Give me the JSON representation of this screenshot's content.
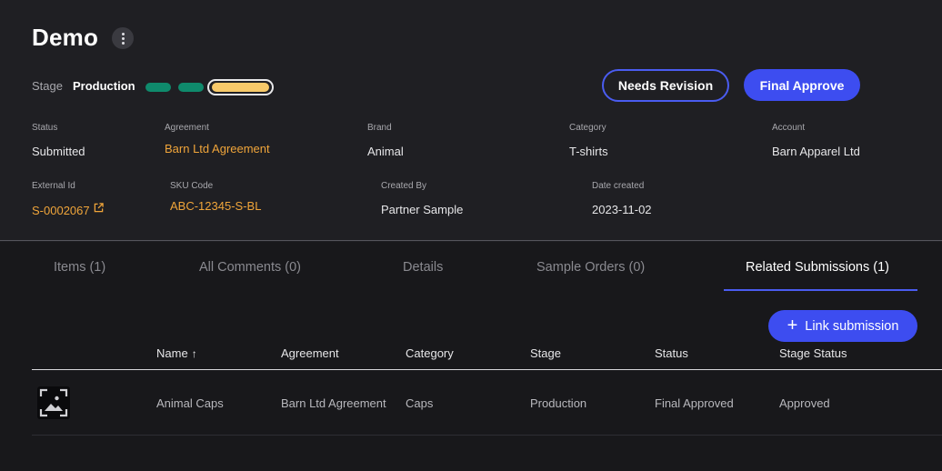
{
  "header": {
    "title": "Demo",
    "stage_label": "Stage",
    "stage_value": "Production"
  },
  "actions": {
    "needs_revision": "Needs Revision",
    "final_approve": "Final Approve"
  },
  "fields": {
    "status": {
      "label": "Status",
      "value": "Submitted"
    },
    "agreement": {
      "label": "Agreement",
      "value": "Barn Ltd Agreement"
    },
    "brand": {
      "label": "Brand",
      "value": "Animal"
    },
    "category": {
      "label": "Category",
      "value": "T-shirts"
    },
    "account": {
      "label": "Account",
      "value": "Barn Apparel Ltd"
    },
    "external_id": {
      "label": "External Id",
      "value": "S-0002067"
    },
    "sku_code": {
      "label": "SKU Code",
      "value": "ABC-12345-S-BL"
    },
    "created_by": {
      "label": "Created By",
      "value": "Partner Sample"
    },
    "date_created": {
      "label": "Date created",
      "value": "2023-11-02"
    }
  },
  "tabs": [
    {
      "label": "Items (1)"
    },
    {
      "label": "All Comments (0)"
    },
    {
      "label": "Details"
    },
    {
      "label": "Sample Orders (0)"
    },
    {
      "label": "Related Submissions (1)"
    }
  ],
  "related": {
    "link_button": "Link submission",
    "columns": [
      "Name",
      "Agreement",
      "Category",
      "Stage",
      "Status",
      "Stage Status"
    ],
    "rows": [
      {
        "name": "Animal Caps",
        "agreement": "Barn Ltd Agreement",
        "category": "Caps",
        "stage": "Production",
        "status": "Final Approved",
        "stage_status": "Approved"
      }
    ]
  },
  "colors": {
    "accent": "#3d4df0",
    "link": "#f0a53a",
    "stage_done": "#0f8a6c",
    "stage_current": "#f7c96a"
  }
}
